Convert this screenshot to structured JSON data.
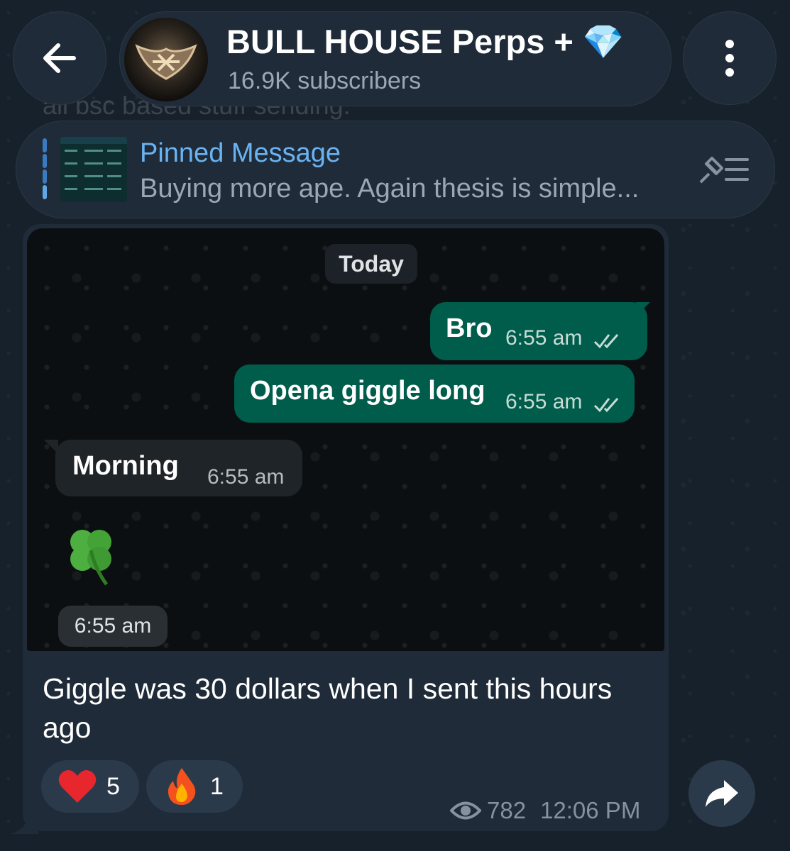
{
  "header": {
    "background_text": "all bsc based stuff sending.",
    "channel_title": "BULL HOUSE Perps + 💎",
    "subscribers": "16.9K subscribers",
    "back_icon": "arrow-left-icon",
    "menu_icon": "vertical-dots-icon"
  },
  "pinned": {
    "label": "Pinned Message",
    "preview": "Buying more ape. Again thesis is simple...",
    "icon": "pin-list-icon"
  },
  "screenshot": {
    "date_chip": "Today",
    "messages": [
      {
        "text": "Bro",
        "time": "6:55 am",
        "direction": "out"
      },
      {
        "text": "Opena giggle long",
        "time": "6:55 am",
        "direction": "out"
      },
      {
        "text": "Morning",
        "time": "6:55 am",
        "direction": "in"
      }
    ],
    "sticker_time": "6:55 am"
  },
  "post": {
    "caption": "Giggle was 30 dollars when I sent this hours ago",
    "reactions": [
      {
        "emoji": "heart",
        "count": "5"
      },
      {
        "emoji": "fire",
        "count": "1"
      }
    ],
    "views": "782",
    "time": "12:06 PM"
  },
  "colors": {
    "background": "#17212b",
    "bubble": "#1f2b38",
    "accent": "#6ab3f3",
    "wa_outgoing": "#005c4b"
  }
}
